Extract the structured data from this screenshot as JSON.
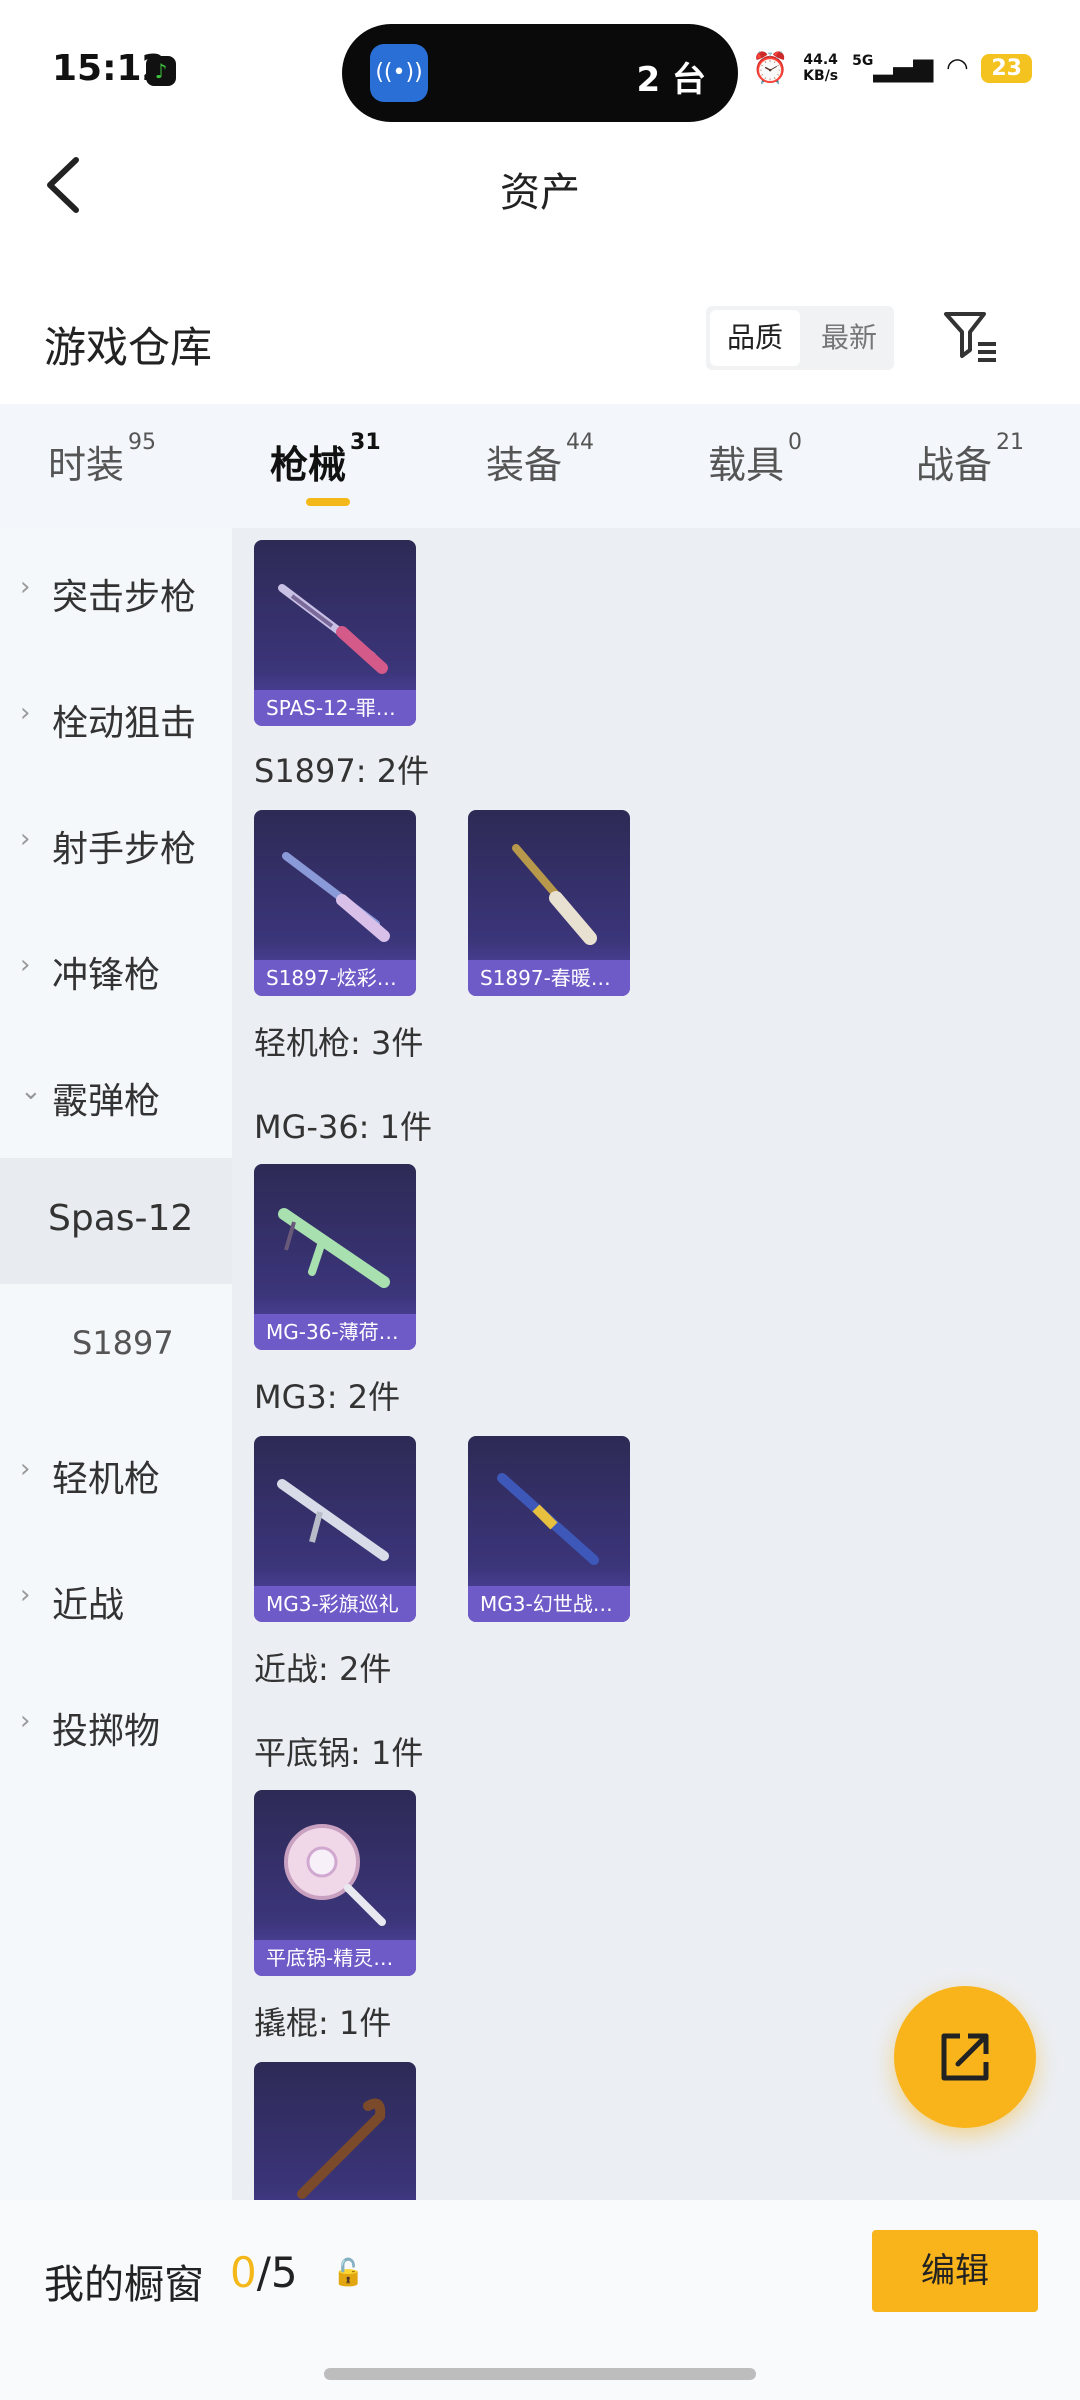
{
  "status_bar": {
    "time": "15:12",
    "island_text": "2 台",
    "island_badge": "2",
    "speed_top": "44.4",
    "speed_unit": "KB/s",
    "network": "5G",
    "battery": "23"
  },
  "header": {
    "title": "资产",
    "back_icon": "chevron-left-icon"
  },
  "section": {
    "title": "游戏仓库",
    "sort_options": [
      "品质",
      "最新"
    ],
    "filter_icon": "filter-list-icon"
  },
  "tabs": [
    {
      "label": "时装",
      "count": "95"
    },
    {
      "label": "枪械",
      "count": "31",
      "active": true
    },
    {
      "label": "装备",
      "count": "44"
    },
    {
      "label": "载具",
      "count": "0"
    },
    {
      "label": "战备",
      "count": "21"
    }
  ],
  "sidebar": [
    {
      "label": "突击步枪",
      "chevron": "›"
    },
    {
      "label": "栓动狙击",
      "chevron": "›"
    },
    {
      "label": "射手步枪",
      "chevron": "›"
    },
    {
      "label": "冲锋枪",
      "chevron": "›"
    },
    {
      "label": "霰弹枪",
      "chevron": "⌄"
    },
    {
      "label": "Spas-12"
    },
    {
      "label": "S1897"
    },
    {
      "label": "轻机枪",
      "chevron": "›"
    },
    {
      "label": "近战",
      "chevron": "›"
    },
    {
      "label": "投掷物",
      "chevron": "›"
    }
  ],
  "content": {
    "labels": [
      "S1897: 2件",
      "轻机枪: 3件",
      "MG-36: 1件",
      "MG3: 2件",
      "近战: 2件",
      "平底锅: 1件",
      "撬棍: 1件"
    ],
    "cards": [
      "SPAS-12-罪…",
      "S1897-炫彩…",
      "S1897-春暖…",
      "MG-36-薄荷…",
      "MG3-彩旗巡礼",
      "MG3-幻世战…",
      "平底锅-精灵…",
      ""
    ]
  },
  "fab": {
    "icon": "share-external-icon"
  },
  "bottom": {
    "title": "我的橱窗",
    "count_current": "0",
    "count_total": "/5",
    "lock_icon": "lock-icon",
    "edit_label": "编辑"
  }
}
